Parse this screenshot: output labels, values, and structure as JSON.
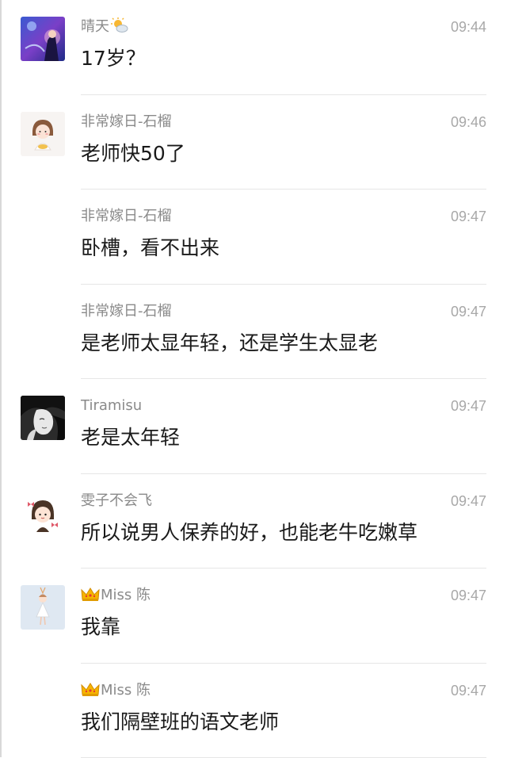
{
  "messages": [
    {
      "name": "晴天",
      "time": "09:44",
      "text": "17岁？",
      "avatar": "anime-girl-avatar",
      "name_suffix_icon": "sun-cloud-emoji-icon"
    },
    {
      "name": "非常嫁日-石榴",
      "time": "09:46",
      "text": "老师快50了",
      "avatar": "cartoon-girl-avatar"
    },
    {
      "name": "非常嫁日-石榴",
      "time": "09:47",
      "text": "卧槽，看不出来"
    },
    {
      "name": "非常嫁日-石榴",
      "time": "09:47",
      "text": "是老师太显年轻，还是学生太显老"
    },
    {
      "name": "Tiramisu",
      "time": "09:47",
      "text": "老是太年轻",
      "avatar": "bw-woman-illustration-avatar"
    },
    {
      "name": "雯子不会飞",
      "time": "09:47",
      "text": "所以说男人保养的好，也能老牛吃嫩草",
      "avatar": "cartoon-girl-bows-avatar"
    },
    {
      "name": "Miss 陈",
      "time": "09:47",
      "text": "我靠",
      "avatar": "dancing-girl-avatar",
      "name_prefix_icon": "crown-icon"
    },
    {
      "name": "Miss 陈",
      "time": "09:47",
      "text": "我们隔壁班的语文老师",
      "name_prefix_icon": "crown-icon"
    }
  ]
}
